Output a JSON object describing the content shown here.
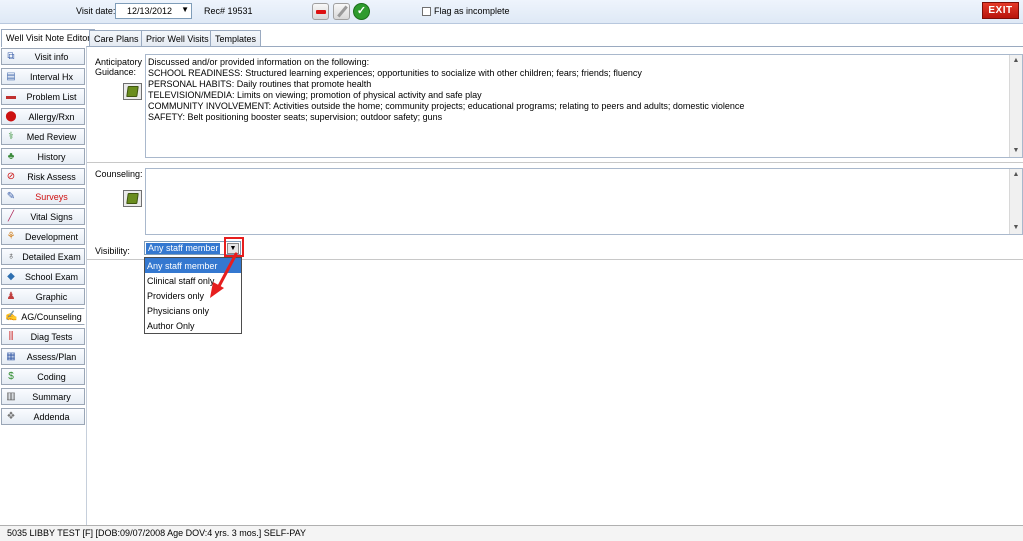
{
  "toolbar": {
    "visit_date_label": "Visit date:",
    "visit_date_value": "12/13/2012",
    "rec_label": "Rec#",
    "rec_value": "19531",
    "flag_label": "Flag as incomplete",
    "exit_label": "EXIT"
  },
  "tabs": [
    {
      "label": "Well Visit Note Editor",
      "active": true
    },
    {
      "label": "Care Plans"
    },
    {
      "label": "Prior Well Visits"
    },
    {
      "label": "Templates"
    }
  ],
  "sidebar": {
    "items": [
      {
        "label": "Visit info",
        "icon": "visit-info-icon"
      },
      {
        "label": "Interval Hx",
        "icon": "document-icon"
      },
      {
        "label": "Problem List",
        "icon": "problem-list-icon"
      },
      {
        "label": "Allergy/Rxn",
        "icon": "allergy-icon"
      },
      {
        "label": "Med Review",
        "icon": "medication-icon"
      },
      {
        "label": "History",
        "icon": "family-tree-icon"
      },
      {
        "label": "Risk Assess",
        "icon": "no-symbol-icon"
      },
      {
        "label": "Surveys",
        "icon": "survey-icon",
        "color": "#d01010"
      },
      {
        "label": "Vital Signs",
        "icon": "thermometer-icon"
      },
      {
        "label": "Development",
        "icon": "development-icon"
      },
      {
        "label": "Detailed Exam",
        "icon": "stethoscope-icon"
      },
      {
        "label": "School Exam",
        "icon": "school-icon"
      },
      {
        "label": "Graphic",
        "icon": "figure-icon"
      },
      {
        "label": "AG/Counseling",
        "icon": "counseling-icon",
        "active": true
      },
      {
        "label": "Diag Tests",
        "icon": "test-tubes-icon"
      },
      {
        "label": "Assess/Plan",
        "icon": "plan-icon"
      },
      {
        "label": "Coding",
        "icon": "dollar-icon"
      },
      {
        "label": "Summary",
        "icon": "summary-icon"
      },
      {
        "label": "Addenda",
        "icon": "addenda-icon"
      }
    ]
  },
  "guidance": {
    "label_line1": "Anticipatory",
    "label_line2": "Guidance:",
    "lines": [
      "Discussed and/or provided information on the following:",
      "SCHOOL READINESS: Structured learning experiences; opportunities to socialize with other children; fears; friends; fluency",
      "PERSONAL HABITS: Daily routines that promote health",
      "TELEVISION/MEDIA: Limits on viewing; promotion of physical activity and safe play",
      "COMMUNITY INVOLVEMENT: Activities outside the home; community projects; educational programs; relating to peers and adults; domestic violence",
      "SAFETY: Belt positioning booster seats; supervision; outdoor safety; guns"
    ]
  },
  "counseling": {
    "label": "Counseling:",
    "value": ""
  },
  "visibility": {
    "label": "Visibility:",
    "selected": "Any staff member",
    "options": [
      "Any staff member",
      "Clinical staff only",
      "Providers only",
      "Physicians only",
      "Author Only"
    ]
  },
  "status_bar": {
    "text": "5035 LIBBY TEST [F] [DOB:09/07/2008 Age DOV:4 yrs. 3 mos.] SELF-PAY"
  },
  "colors": {
    "selection": "#3478d0",
    "annotation_red": "#e61e1e",
    "exit_red": "#c41c10"
  }
}
